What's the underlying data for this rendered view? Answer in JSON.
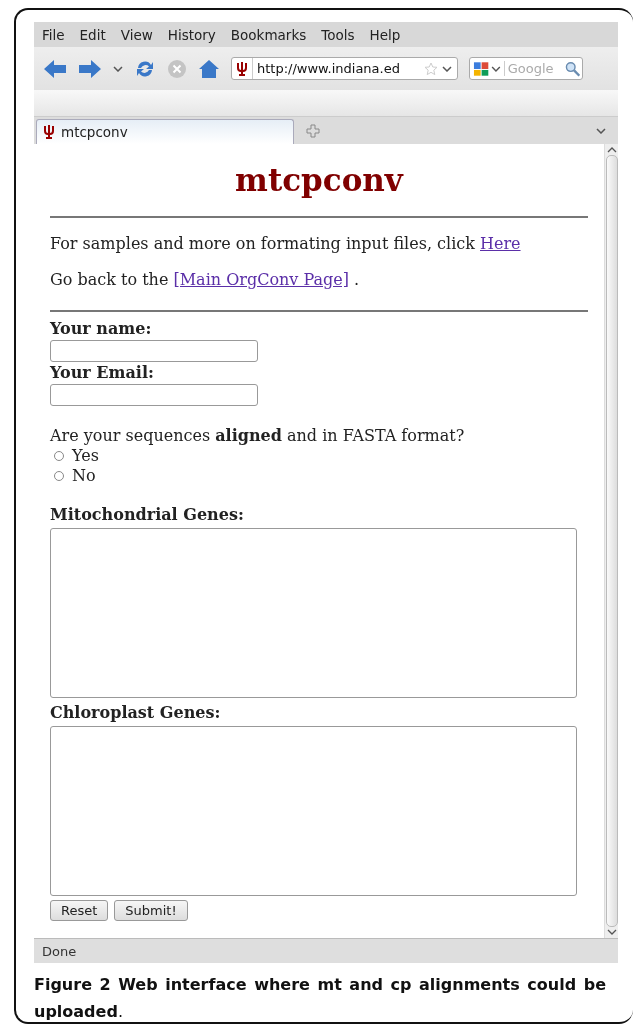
{
  "menu": [
    {
      "label": "File"
    },
    {
      "label": "Edit"
    },
    {
      "label": "View"
    },
    {
      "label": "History"
    },
    {
      "label": "Bookmarks"
    },
    {
      "label": "Tools"
    },
    {
      "label": "Help"
    }
  ],
  "toolbar": {
    "url": "http://www.indiana.ed",
    "search": {
      "placeholder": "Google"
    }
  },
  "tabs": [
    {
      "label": "mtcpconv",
      "selected": true
    }
  ],
  "page": {
    "title": "mtcpconv",
    "samples_text": "For samples and more on formating input files, click",
    "samples_link": "Here",
    "back_text": "Go back to the",
    "back_link": "[Main OrgConv Page]",
    "back_end": ".",
    "fields": [
      {
        "label": "Your name:"
      },
      {
        "label": "Your Email:"
      }
    ],
    "question": "Are your sequences **aligned** and in FASTA format?",
    "options": [
      {
        "label": "Yes",
        "selected": false
      },
      {
        "label": "No",
        "selected": false
      }
    ],
    "textareas": [
      {
        "label": "Mitochondrial Genes:"
      },
      {
        "label": "Chloroplast Genes:"
      }
    ],
    "buttons": [
      "Reset",
      "Submit!"
    ]
  },
  "status_bar": "Done",
  "caption": "**Figure 2 Web interface where mt and cp alignments could be uploaded**."
}
